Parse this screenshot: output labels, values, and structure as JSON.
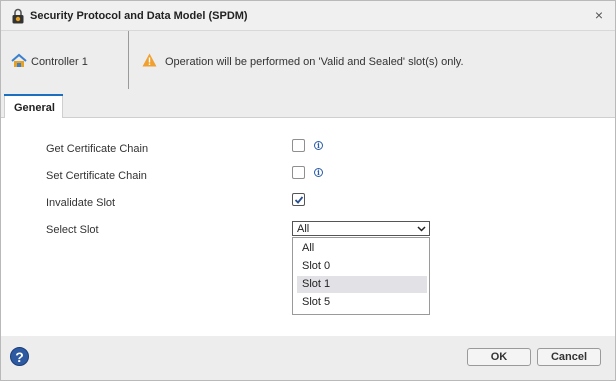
{
  "dialog": {
    "title": "Security Protocol and Data Model (SPDM)",
    "close_glyph": "×"
  },
  "info": {
    "controller_label": "Controller 1",
    "warning_text": "Operation will be performed on 'Valid and Sealed' slot(s) only."
  },
  "tabs": [
    {
      "label": "General",
      "active": true
    }
  ],
  "form": {
    "get_chain": {
      "label": "Get Certificate Chain",
      "checked": false
    },
    "set_chain": {
      "label": "Set Certificate Chain",
      "checked": false
    },
    "invalidate_slot": {
      "label": "Invalidate Slot",
      "checked": true
    },
    "select_slot": {
      "label": "Select Slot",
      "value": "All",
      "options": [
        "All",
        "Slot 0",
        "Slot 1",
        "Slot 5"
      ],
      "highlighted": "Slot 1"
    },
    "info_glyph": "i"
  },
  "footer": {
    "help_glyph": "?",
    "ok_label": "OK",
    "cancel_label": "Cancel"
  },
  "colors": {
    "accent": "#1c6fbf",
    "warning": "#f0a030",
    "help": "#2d5aa0"
  }
}
